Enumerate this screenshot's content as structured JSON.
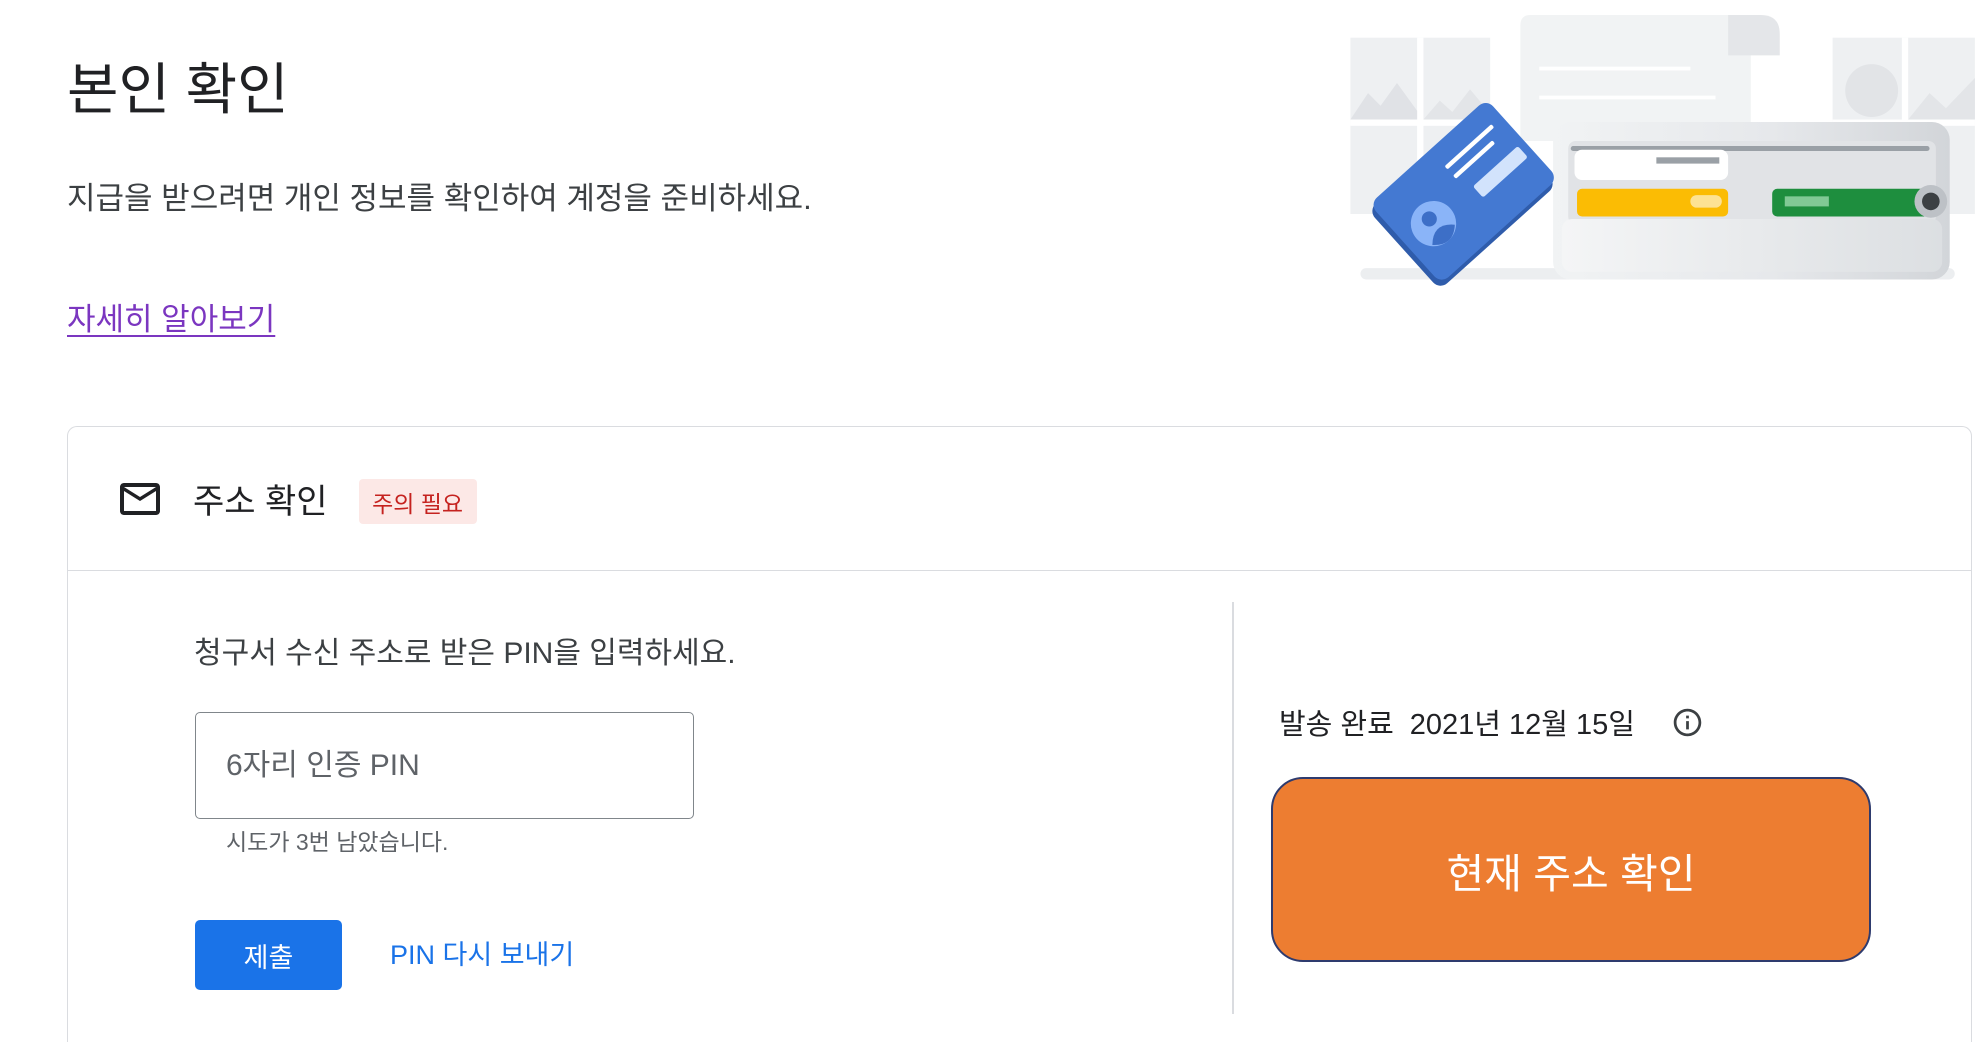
{
  "page": {
    "title": "본인 확인",
    "description": "지급을 받으려면 개인 정보를 확인하여 계정을 준비하세요.",
    "learn_more_link": "자세히 알아보기",
    "illustration": "wallet-with-id-card-illustration"
  },
  "address_card": {
    "icon": "mail-icon",
    "title": "주소 확인",
    "status_badge": "주의 필요",
    "pin_form": {
      "instruction": "청구서 수신 주소로 받은 PIN을 입력하세요.",
      "pin_input": {
        "placeholder": "6자리 인증 PIN",
        "value": ""
      },
      "attempts_remaining": "시도가 3번 남았습니다.",
      "submit_label": "제출",
      "resend_label": "PIN 다시 보내기"
    },
    "mail_status": {
      "sent_label": "발송 완료",
      "sent_date": "2021년 12월 15일",
      "info_icon": "info-icon",
      "confirm_address_label": "현재 주소 확인"
    }
  },
  "colors": {
    "title_text": "#202124",
    "body_text": "#3c4043",
    "link_visited": "#7b36c0",
    "primary_blue": "#1a73e8",
    "badge_text": "#c5221f",
    "badge_background": "#fce8e6",
    "confirm_button": "#ed7d31",
    "divider": "#dadce0"
  }
}
